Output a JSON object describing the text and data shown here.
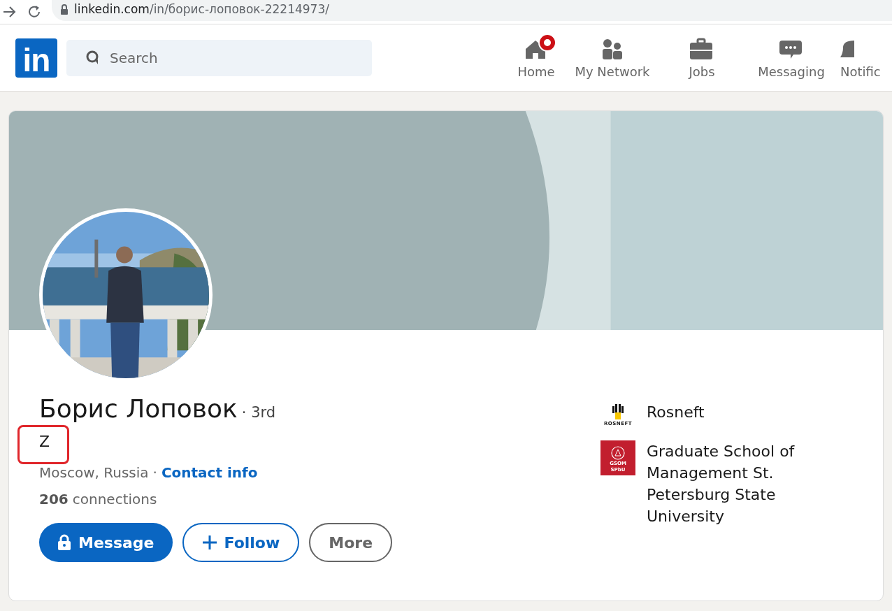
{
  "browser": {
    "url_host": "linkedin.com",
    "url_path": "/in/борис-лоповок-22214973/"
  },
  "nav": {
    "logo": "in",
    "search": {
      "placeholder": "Search"
    },
    "items": [
      {
        "label": "Home",
        "kind": "home",
        "badge": true
      },
      {
        "label": "My Network",
        "kind": "network",
        "badge": false
      },
      {
        "label": "Jobs",
        "kind": "jobs",
        "badge": false
      },
      {
        "label": "Messaging",
        "kind": "messaging",
        "badge": false
      },
      {
        "label": "Notific",
        "kind": "notifications",
        "badge": false
      }
    ]
  },
  "profile": {
    "name": "Борис Лоповок",
    "degree": "· 3rd",
    "headline": "Z",
    "headline_highlighted": true,
    "location": "Moscow, Russia",
    "separator": "·",
    "contact_link": "Contact info",
    "connections_count": "206",
    "connections_label": "connections",
    "buttons": [
      {
        "label": "Message",
        "kind": "primary"
      },
      {
        "label": "Follow",
        "kind": "follow"
      },
      {
        "label": "More",
        "kind": "secondary"
      }
    ],
    "organizations": [
      {
        "name": "Rosneft",
        "kind": "company",
        "logo_text": [
          "ROSNEFT"
        ]
      },
      {
        "name": "Graduate School of Management St. Petersburg State University",
        "kind": "school",
        "logo_text": [
          "GSOM",
          "SPbU"
        ]
      }
    ]
  }
}
